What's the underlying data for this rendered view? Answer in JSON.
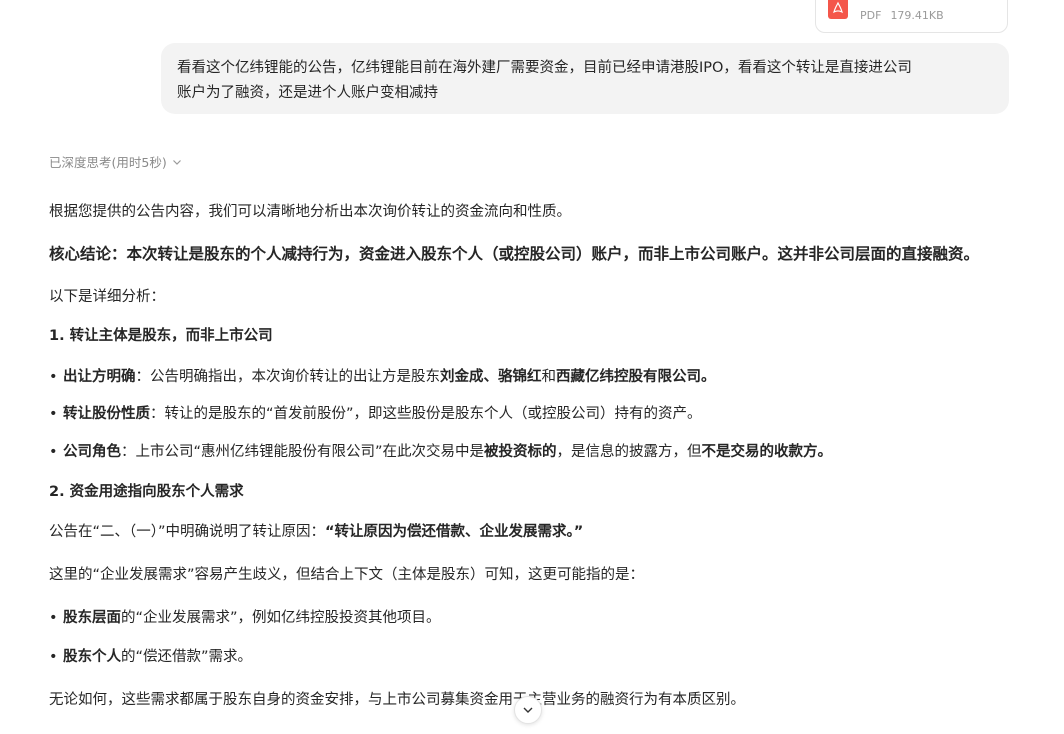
{
  "attachment": {
    "type_label": "PDF",
    "size": "179.41KB",
    "icon": "pdf-file-icon"
  },
  "user_message": {
    "line1": "看看这个亿纬锂能的公告，亿纬锂能目前在海外建厂需要资金，目前已经申请港股IPO，看看这个转让是直接进公司",
    "line2": "账户为了融资，还是进个人账户变相减持"
  },
  "thinking": {
    "label": "已深度思考(用时5秒)",
    "icon": "chevron-down-icon"
  },
  "answer": {
    "intro": "根据您提供的公告内容，我们可以清晰地分析出本次询价转让的资金流向和性质。",
    "conclusion": "核心结论：本次转让是股东的个人减持行为，资金进入股东个人（或控股公司）账户，而非上市公司账户。这并非公司层面的直接融资。",
    "detail_lead": "以下是详细分析：",
    "section1_title": "1. 转让主体是股东，而非上市公司",
    "s1_b1_label": "出让方明确",
    "s1_b1_text_a": "：公告明确指出，本次询价转让的出让方是股东",
    "s1_b1_name1": "刘金成、骆锦红",
    "s1_b1_and": "和",
    "s1_b1_name2": "西藏亿纬控股有限公司。",
    "s1_b2_label": "转让股份性质",
    "s1_b2_text": "：转让的是股东的“首发前股份”，即这些股份是股东个人（或控股公司）持有的资产。",
    "s1_b3_label": "公司角色",
    "s1_b3_text_a": "：上市公司“惠州亿纬锂能股份有限公司”在此次交易中是",
    "s1_b3_bold1": "被投资标的",
    "s1_b3_text_b": "，是信息的披露方，但",
    "s1_b3_bold2": "不是交易的收款方。",
    "section2_title": "2. 资金用途指向股东个人需求",
    "s2_p1_a": "公告在“二、（一）”中明确说明了转让原因：",
    "s2_p1_bold": "“转让原因为偿还借款、企业发展需求。”",
    "s2_p2": "这里的“企业发展需求”容易产生歧义，但结合上下文（主体是股东）可知，这更可能指的是：",
    "s2_b1_label": "股东层面",
    "s2_b1_text": "的“企业发展需求”，例如亿纬控股投资其他项目。",
    "s2_b2_label": "股东个人",
    "s2_b2_text": "的“偿还借款”需求。",
    "s2_p3": "无论如何，这些需求都属于股东自身的资金安排，与上市公司募集资金用于主营业务的融资行为有本质区别。"
  },
  "scroll_button": {
    "icon": "arrow-down-icon"
  }
}
